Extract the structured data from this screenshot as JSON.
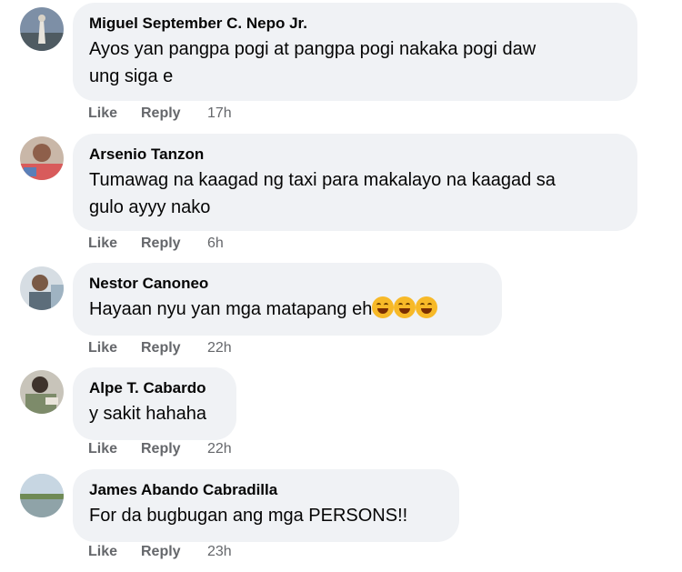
{
  "comments": [
    {
      "author": "Miguel September C. Nepo Jr.",
      "text_line1": "Ayos yan pangpa pogi at pangpa pogi nakaka pogi daw",
      "text_line2": "ung siga e",
      "like": "Like",
      "reply": "Reply",
      "time": "17h"
    },
    {
      "author": "Arsenio Tanzon",
      "text_line1": "Tumawag na kaagad ng taxi para makalayo na kaagad sa",
      "text_line2": "gulo ayyy nako",
      "like": "Like",
      "reply": "Reply",
      "time": "6h"
    },
    {
      "author": "Nestor Canoneo",
      "text_line1": "Hayaan nyu yan mga matapang eh",
      "emoji": "rolling-on-floor-laughing-emoji",
      "like": "Like",
      "reply": "Reply",
      "time": "22h"
    },
    {
      "author": "Alpe T. Cabardo",
      "text_line1": "y sakit hahaha",
      "like": "Like",
      "reply": "Reply",
      "time": "22h"
    },
    {
      "author": "James Abando Cabradilla",
      "text_line1": "For da bugbugan ang mga PERSONS!!",
      "like": "Like",
      "reply": "Reply",
      "time": "23h"
    }
  ]
}
